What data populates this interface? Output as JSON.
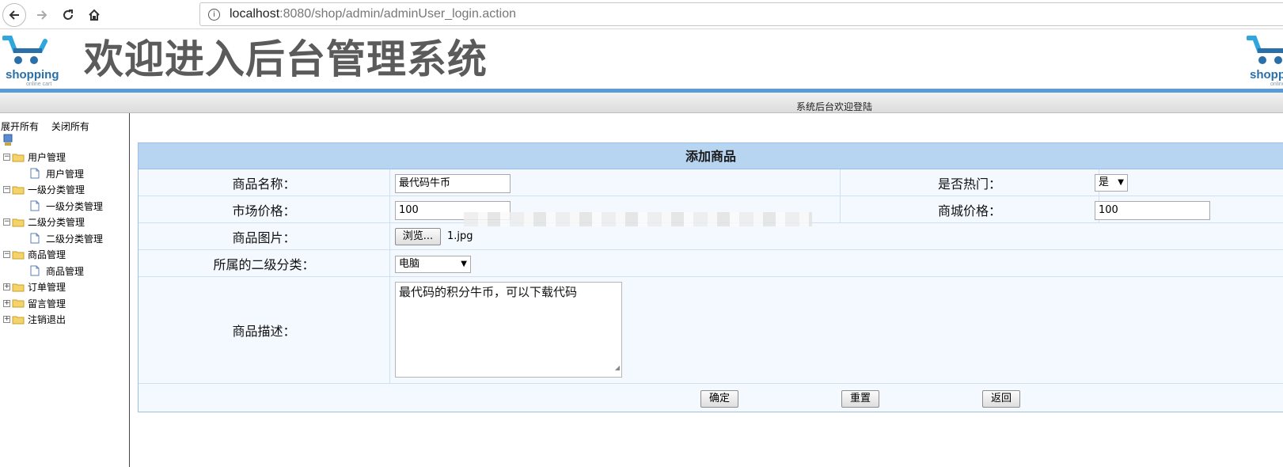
{
  "browser": {
    "url_host": "localhost",
    "url_rest": ":8080/shop/admin/adminUser_login.action",
    "info_glyph": "i"
  },
  "header": {
    "logo_text": "shopping",
    "logo_sub": "online cart",
    "title": "欢迎进入后台管理系统",
    "welcome": "系统后台欢迎登陆"
  },
  "sidebar": {
    "expand_all": "展开所有",
    "collapse_all": "关闭所有",
    "tree": [
      {
        "label": "用户管理",
        "toggle": "−",
        "children": [
          "用户管理"
        ]
      },
      {
        "label": "一级分类管理",
        "toggle": "−",
        "children": [
          "一级分类管理"
        ]
      },
      {
        "label": "二级分类管理",
        "toggle": "−",
        "children": [
          "二级分类管理"
        ]
      },
      {
        "label": "商品管理",
        "toggle": "−",
        "children": [
          "商品管理"
        ]
      },
      {
        "label": "订单管理",
        "toggle": "+",
        "children": []
      },
      {
        "label": "留言管理",
        "toggle": "+",
        "children": []
      },
      {
        "label": "注销退出",
        "toggle": "+",
        "children": []
      }
    ]
  },
  "form": {
    "title": "添加商品",
    "name_label": "商品名称：",
    "name_value": "最代码牛币",
    "hot_label": "是否热门：",
    "hot_value": "是",
    "market_price_label": "市场价格：",
    "market_price_value": "100",
    "shop_price_label": "商城价格：",
    "shop_price_value": "100",
    "image_label": "商品图片：",
    "browse_button": "浏览...",
    "image_file": "1.jpg",
    "category_label": "所属的二级分类：",
    "category_value": "电脑",
    "desc_label": "商品描述：",
    "desc_value": "最代码的积分牛币，可以下载代码",
    "confirm_button": "确定",
    "reset_button": "重置",
    "back_button": "返回"
  },
  "colors": {
    "accent_blue": "#5b9bd5",
    "form_header_bg": "#b7d4f0",
    "title_gray": "#5b5b5b"
  }
}
